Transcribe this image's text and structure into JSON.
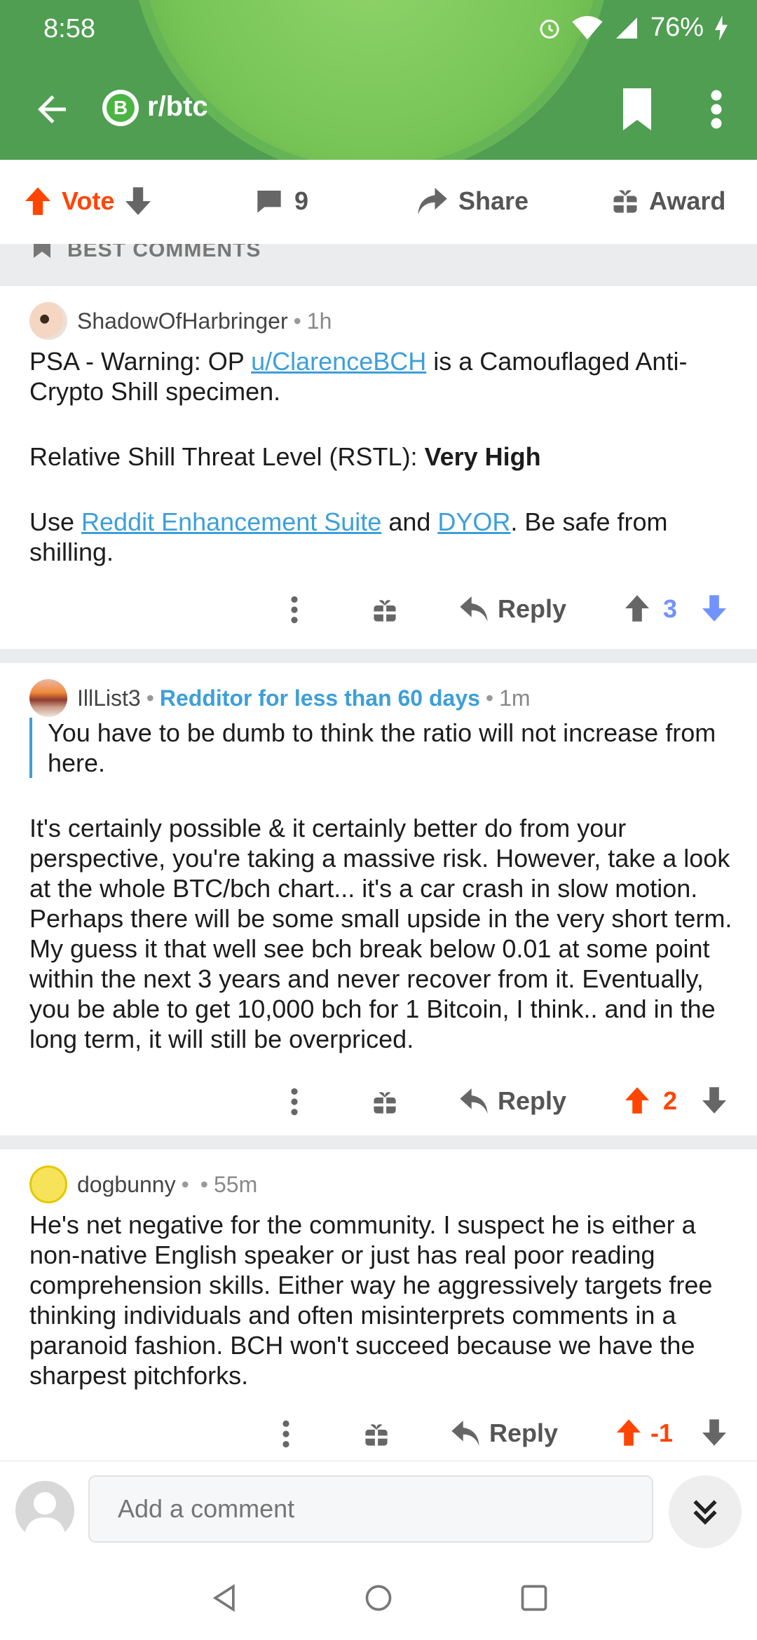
{
  "status_bar": {
    "time": "8:58",
    "battery": "76%"
  },
  "appbar": {
    "subreddit": "r/btc",
    "subreddit_icon_letter": "B"
  },
  "action_bar": {
    "vote_label": "Vote",
    "comment_count": "9",
    "share_label": "Share",
    "award_label": "Award"
  },
  "sort": {
    "label": "BEST COMMENTS"
  },
  "comments": [
    {
      "author": "ShadowOfHarbringer",
      "time": "1h",
      "p1_a": "PSA - Warning: OP ",
      "p1_link": "u/ClarenceBCH",
      "p1_b": " is a Camouflaged Anti-Crypto Shill specimen.",
      "p2_a": "Relative Shill Threat Level (RSTL): ",
      "p2_bold": "Very High",
      "p3_a": "Use ",
      "p3_link1": "Reddit Enhancement Suite",
      "p3_mid": " and ",
      "p3_link2": "DYOR",
      "p3_b": ". Be safe from shilling.",
      "reply_label": "Reply",
      "score": "3",
      "vote_state": "downvoted"
    },
    {
      "author": "IllList3",
      "flair": "Redditor for less than 60 days",
      "time": "1m",
      "quote": "You have to be dumb to think the ratio will not increase from here.",
      "text": "It's certainly possible & it certainly better do from your perspective,  you're taking a massive risk. However, take a look at the whole BTC/bch chart...  it's a car crash in slow motion.  Perhaps there will be some small upside in the very short term.  My guess it that well see bch break below 0.01 at some point within the next 3 years and never recover from it. Eventually,  you be able to get 10,000 bch for 1 Bitcoin, I think.. and in the long term, it will still be overpriced.",
      "reply_label": "Reply",
      "score": "2",
      "vote_state": "upvoted"
    },
    {
      "author": "dogbunny",
      "time": "55m",
      "text": "He's net negative for the community. I suspect he is either a non-native English speaker or just has real poor reading comprehension skills. Either way he aggressively targets free thinking individuals and often misinterprets comments in a paranoid fashion. BCH won't succeed because we have the sharpest pitchforks.",
      "reply_label": "Reply",
      "score": "-1",
      "vote_state": "upvoted"
    }
  ],
  "composer": {
    "placeholder": "Add a comment"
  },
  "colors": {
    "header_green": "#4f9e52",
    "upvote_orange": "#ff4500",
    "downvote_blue": "#7193ff",
    "link_blue": "#3d9fd9"
  },
  "icons": [
    "back-arrow-icon",
    "bitcoin-icon",
    "bookmark-icon",
    "more-vert-icon",
    "upvote-icon",
    "downvote-icon",
    "comment-icon",
    "share-icon",
    "award-icon",
    "reply-icon",
    "chevrons-down-icon",
    "nav-back-icon",
    "nav-home-icon",
    "nav-recents-icon"
  ]
}
